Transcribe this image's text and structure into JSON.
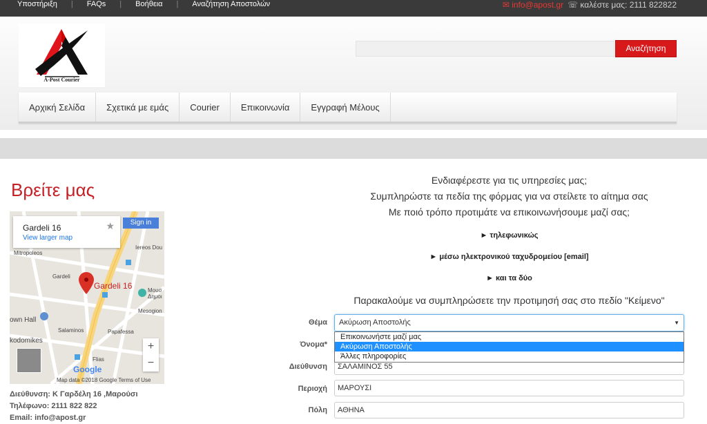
{
  "topbar": {
    "links": [
      "Υποστήριξη",
      "FAQs",
      "Βοήθεια",
      "Αναζήτηση Αποστολών"
    ],
    "separator": "|",
    "email": "✉ info@apost.gr",
    "phone": "☏ καλέστε μας: 2111 822822"
  },
  "logo": {
    "text": "A-Post Courier"
  },
  "search": {
    "placeholder": "",
    "button_label": "Αναζήτηση"
  },
  "nav": {
    "items": [
      "Αρχική Σελίδα",
      "Σχετικά με εμάς",
      "Courier",
      "Επικοινωνία",
      "Εγγραφή Μέλους"
    ]
  },
  "find_us": {
    "title": "Βρείτε μας"
  },
  "map": {
    "card_title": "Gardeli 16",
    "card_link": "View larger map",
    "signin_label": "Sign in",
    "pin_label": "Gardeli 16",
    "footer": "Map data ©2018 Google    Terms of Use",
    "google_label": "Google",
    "zoom_in": "+",
    "zoom_out": "−",
    "labels": {
      "mitropoleos": "Mitropoleos",
      "ieroos": "Iereos Dou",
      "gardeli": "Gardeli",
      "mouseio": "Μουσ Δημοι",
      "mesogion": "Mesogion",
      "papafessa": "Papafessa",
      "town_hall": "own Hall",
      "kodomikes": "kodomikes",
      "salaminos": "Salaminos",
      "flias": "Flias"
    }
  },
  "contact_info": {
    "address": "Διεύθυνση: Κ Γαρδέλη 16 ,Μαρούσι",
    "phone": "Τηλέφωνο: 2111 822 822",
    "email": "Email: info@apost.gr"
  },
  "form": {
    "intro_1": "Ενδιαφέρεστε για τις υπηρεσίες μας;",
    "intro_2": "Συμπληρώστε  τα πεδία της φόρμας για να στείλετε το αίτημα σας",
    "intro_3": "Με ποιό τρόπο προτιμάτε να επικοινωνήσουμε μαζί σας;",
    "option_phone": "► τηλεφωνικώς",
    "option_email": "► μέσω ηλεκτρονικού ταχυδρομείου [email]",
    "option_both": "► και τα δύο",
    "notice": "Παρακαλούμε να συμπληρώσετε την προτιμησή σας στο πεδίο \"Κείμενο\"",
    "subject_label": "Θέμα",
    "subject_value": "Ακύρωση Αποστολής",
    "subject_options": [
      "Επικοινωνήστε μαζί μας",
      "Ακύρωση Αποστολής",
      "Άλλες πληροφορίες"
    ],
    "name_label": "Όνομα*",
    "address_label": "Διεύθυνση",
    "address_value": "ΣΑΛΑΜΙΝΟΣ 55",
    "area_label": "Περιοχή",
    "area_value": "ΜΑΡΟΥΣΙ",
    "city_label": "Πόλη",
    "city_value": "ΑΘΗΝΑ"
  },
  "colors": {
    "accent": "#d7191c",
    "topbar": "#3a3a3a",
    "title_red": "#c42026"
  }
}
